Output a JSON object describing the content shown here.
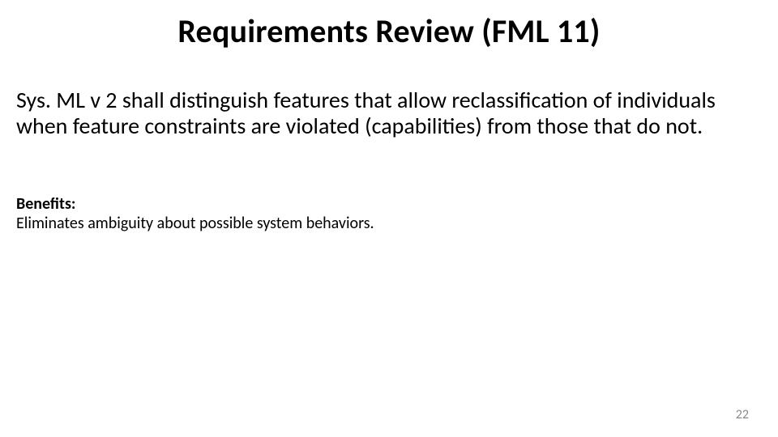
{
  "slide": {
    "title": "Requirements Review (FML 11)",
    "body": "Sys. ML v 2 shall distinguish features that allow reclassification of individuals when feature constraints are violated (capabilities) from those that do not.",
    "benefits_label": "Benefits:",
    "benefits_text": "Eliminates ambiguity about possible system behaviors.",
    "page_number": "22"
  }
}
